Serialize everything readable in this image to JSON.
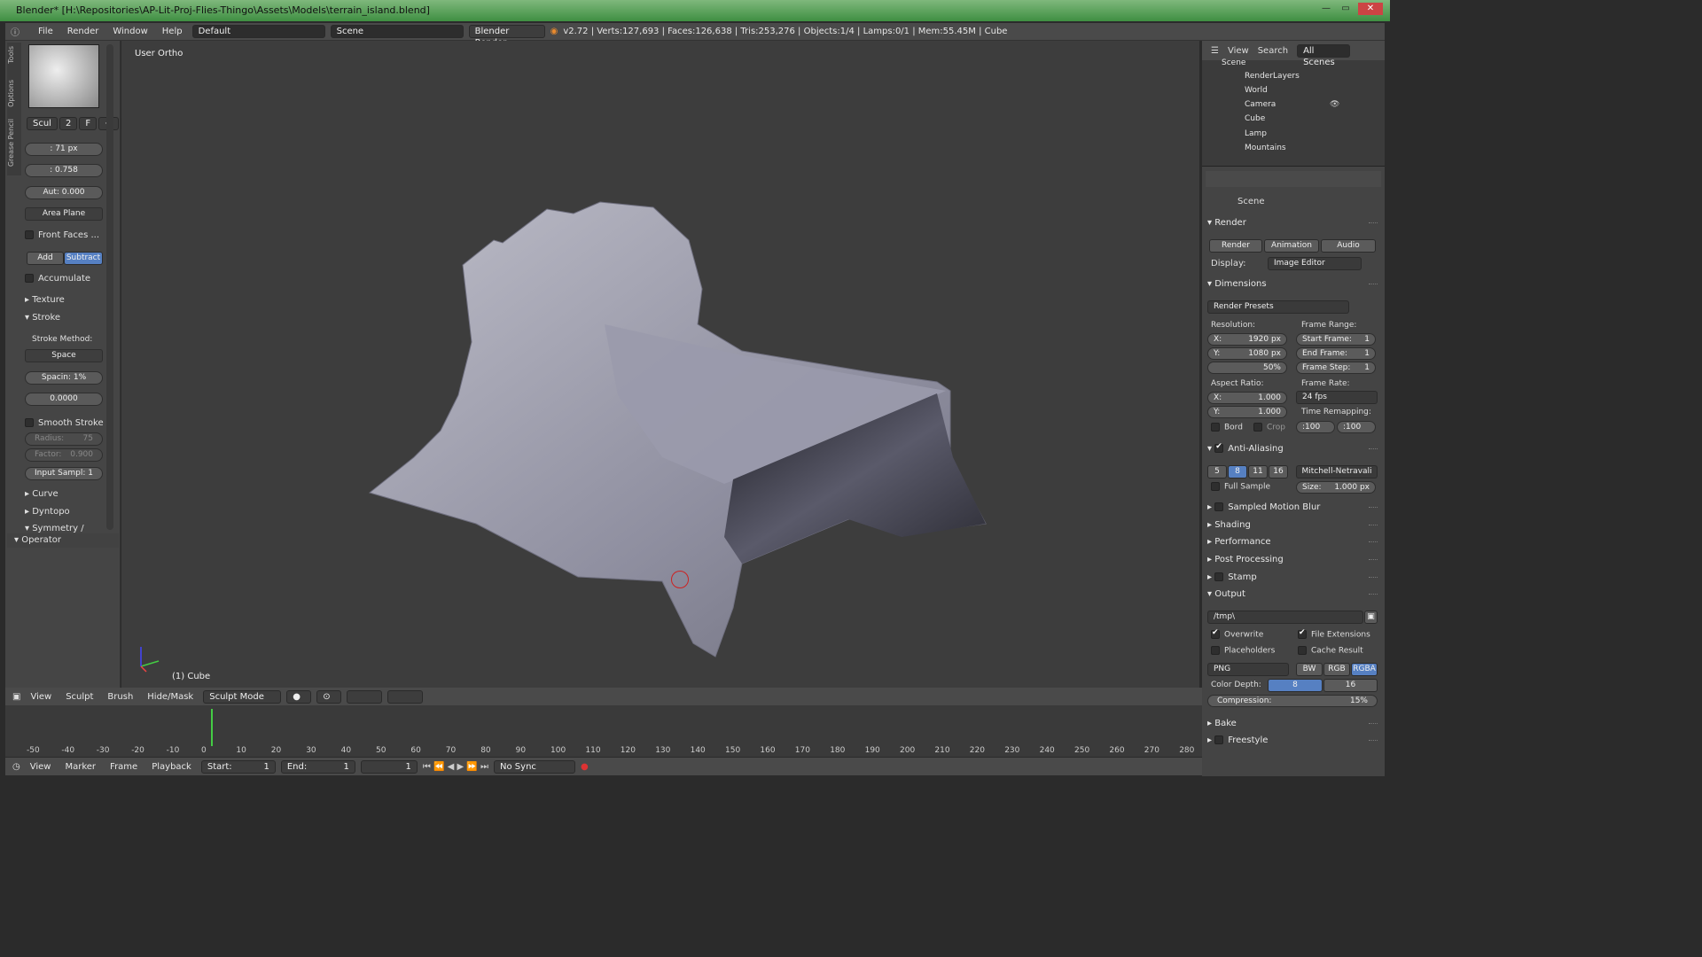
{
  "window": {
    "title": "Blender* [H:\\Repositories\\AP-Lit-Proj-Flies-Thingo\\Assets\\Models\\terrain_island.blend]"
  },
  "menu": {
    "file": "File",
    "render": "Render",
    "window": "Window",
    "help": "Help"
  },
  "layout": "Default",
  "scene": "Scene",
  "engine": "Blender Render",
  "stats": "v2.72 | Verts:127,693 | Faces:126,638 | Tris:253,276 | Objects:1/4 | Lamps:0/1 | Mem:55.45M | Cube",
  "viewport": {
    "view_label": "User Ortho",
    "object_label": "(1) Cube"
  },
  "tools": {
    "tabs": [
      "Tools",
      "Options",
      "Grease Pencil"
    ],
    "brush": "Scul",
    "brush_num": "2",
    "brush_f": "F",
    "radius": ": 71 px",
    "strength": ": 0.758",
    "autosmooth": "Aut: 0.000",
    "area": "Area Plane",
    "front_faces": "Front Faces ...",
    "add": "Add",
    "subtract": "Subtract",
    "accumulate": "Accumulate",
    "texture": "Texture",
    "stroke": "Stroke",
    "stroke_method_label": "Stroke Method:",
    "stroke_method": "Space",
    "spacing": "Spacin: 1%",
    "jitter": "0.0000",
    "smooth_stroke": "Smooth Stroke",
    "smooth_radius": "Radius:",
    "smooth_radius_val": "75",
    "factor": "Factor:",
    "factor_val": "0.900",
    "input_samples": "Input Sampl: 1",
    "curve": "Curve",
    "dyntopo": "Dyntopo",
    "symmetry": "Symmetry / Lock",
    "operator": "Operator"
  },
  "outliner": {
    "view": "View",
    "search": "Search",
    "filter": "All Scenes",
    "items": [
      "Scene",
      "RenderLayers",
      "World",
      "Camera",
      "Cube",
      "Lamp",
      "Mountains"
    ]
  },
  "props": {
    "scene": "Scene",
    "render": "Render",
    "btn_render": "Render",
    "btn_animation": "Animation",
    "btn_audio": "Audio",
    "display_label": "Display:",
    "display": "Image Editor",
    "dimensions": "Dimensions",
    "presets": "Render Presets",
    "resolution": "Resolution:",
    "res_x": "X:",
    "res_x_val": "1920 px",
    "res_y": "Y:",
    "res_y_val": "1080 px",
    "res_pct": "50%",
    "frame_range": "Frame Range:",
    "start_frame": "Start Frame:",
    "start_frame_val": "1",
    "end_frame": "End Frame:",
    "end_frame_val": "1",
    "frame_step": "Frame Step:",
    "frame_step_val": "1",
    "aspect": "Aspect Ratio:",
    "asp_x": "X:",
    "asp_x_val": "1.000",
    "asp_y": "Y:",
    "asp_y_val": "1.000",
    "frame_rate": "Frame Rate:",
    "fps": "24 fps",
    "time_remap": "Time Remapping:",
    "remap_old": ":100",
    "remap_new": ":100",
    "bord": "Bord",
    "crop": "Crop",
    "aa": "Anti-Aliasing",
    "aa_levels": [
      "5",
      "8",
      "11",
      "16"
    ],
    "aa_filter": "Mitchell-Netravali",
    "full_sample": "Full Sample",
    "size": "Size:",
    "size_val": "1.000 px",
    "motion_blur": "Sampled Motion Blur",
    "shading": "Shading",
    "performance": "Performance",
    "post": "Post Processing",
    "stamp": "Stamp",
    "output": "Output",
    "path": "/tmp\\",
    "overwrite": "Overwrite",
    "file_ext": "File Extensions",
    "placeholders": "Placeholders",
    "cache": "Cache Result",
    "format": "PNG",
    "bw": "BW",
    "rgb": "RGB",
    "rgba": "RGBA",
    "color_depth": "Color Depth:",
    "depth8": "8",
    "depth16": "16",
    "compression": "Compression:",
    "compression_val": "15%",
    "bake": "Bake",
    "freestyle": "Freestyle"
  },
  "bottom": {
    "view": "View",
    "sculpt": "Sculpt",
    "brush": "Brush",
    "hidemask": "Hide/Mask",
    "mode": "Sculpt Mode"
  },
  "timeline": {
    "ticks": [
      "-50",
      "-40",
      "-30",
      "-20",
      "-10",
      "0",
      "10",
      "20",
      "30",
      "40",
      "50",
      "60",
      "70",
      "80",
      "90",
      "100",
      "110",
      "120",
      "130",
      "140",
      "150",
      "160",
      "170",
      "180",
      "190",
      "200",
      "210",
      "220",
      "230",
      "240",
      "250",
      "260",
      "270",
      "280"
    ],
    "view": "View",
    "marker": "Marker",
    "frame": "Frame",
    "playback": "Playback",
    "start": "Start:",
    "start_val": "1",
    "end": "End:",
    "end_val": "1",
    "current": "1",
    "sync": "No Sync"
  }
}
